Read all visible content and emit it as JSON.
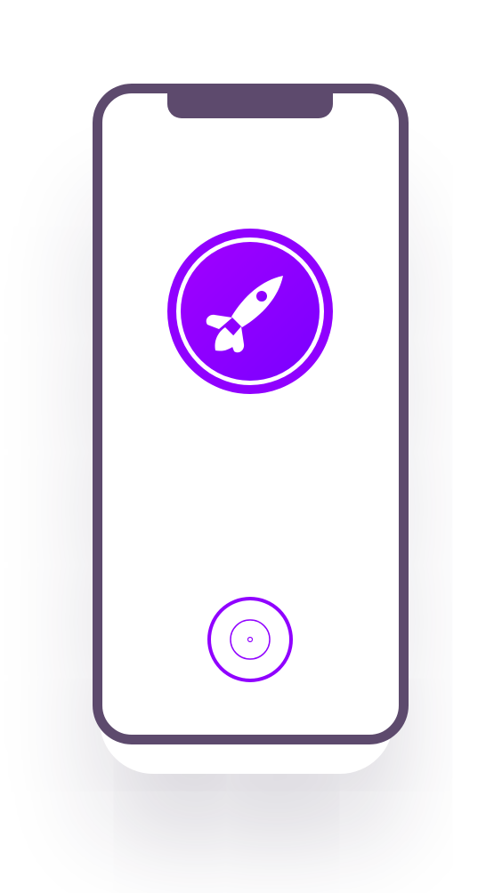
{
  "device": {
    "frame_color": "#5d4a6d",
    "screen_color": "#ffffff"
  },
  "app_logo": {
    "icon": "rocket-icon",
    "gradient_start": "#a100ff",
    "gradient_end": "#7a00ff",
    "ring_color": "#9000ff"
  },
  "home_button": {
    "icon": "home-button-target-icon",
    "color": "#9000ff"
  }
}
